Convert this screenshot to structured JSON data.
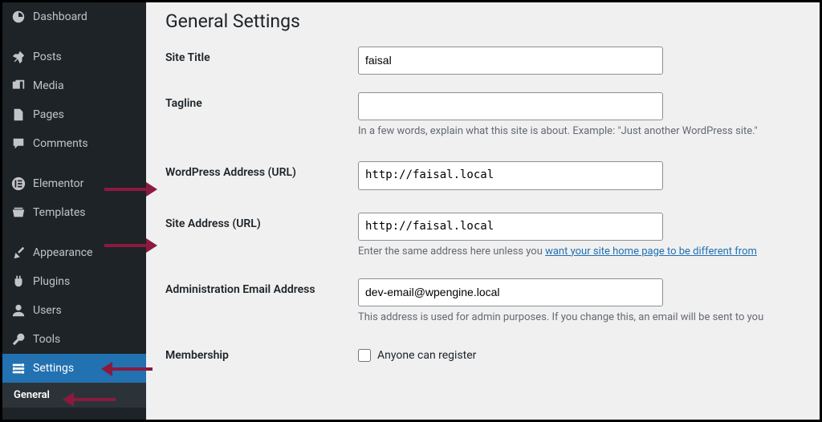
{
  "sidebar": {
    "items": [
      {
        "label": "Dashboard",
        "icon": "dashboard"
      },
      {
        "label": "Posts",
        "icon": "pin"
      },
      {
        "label": "Media",
        "icon": "media"
      },
      {
        "label": "Pages",
        "icon": "pages"
      },
      {
        "label": "Comments",
        "icon": "comments"
      },
      {
        "label": "Elementor",
        "icon": "elementor"
      },
      {
        "label": "Templates",
        "icon": "templates"
      },
      {
        "label": "Appearance",
        "icon": "appearance"
      },
      {
        "label": "Plugins",
        "icon": "plugins"
      },
      {
        "label": "Users",
        "icon": "users"
      },
      {
        "label": "Tools",
        "icon": "tools"
      },
      {
        "label": "Settings",
        "icon": "settings"
      }
    ],
    "sub_general": "General"
  },
  "page": {
    "title": "General Settings"
  },
  "form": {
    "site_title": {
      "label": "Site Title",
      "value": "faisal"
    },
    "tagline": {
      "label": "Tagline",
      "value": "",
      "help": "In a few words, explain what this site is about. Example: \"Just another WordPress site.\""
    },
    "wp_url": {
      "label": "WordPress Address (URL)",
      "value": "http://faisal.local"
    },
    "site_url": {
      "label": "Site Address (URL)",
      "value": "http://faisal.local",
      "help_prefix": "Enter the same address here unless you ",
      "help_link": "want your site home page to be different from "
    },
    "admin_email": {
      "label": "Administration Email Address",
      "value": "dev-email@wpengine.local",
      "help": "This address is used for admin purposes. If you change this, an email will be sent to you"
    },
    "membership": {
      "label": "Membership",
      "checkbox_label": "Anyone can register",
      "checked": false
    }
  }
}
